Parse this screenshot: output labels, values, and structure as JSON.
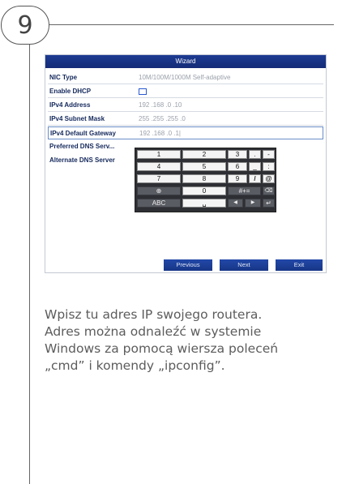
{
  "step": {
    "number": "9"
  },
  "wizard": {
    "title": "Wizard",
    "rows": [
      {
        "label": "NIC Type",
        "value": "10M/100M/1000M Self-adaptive"
      },
      {
        "label": "Enable DHCP",
        "value": ""
      },
      {
        "label": "IPv4 Address",
        "value": "192 .168 .0    .10"
      },
      {
        "label": "IPv4 Subnet Mask",
        "value": "255 .255 .255 .0"
      },
      {
        "label": "IPv4 Default Gateway",
        "value": "192 .168 .0    .1|"
      },
      {
        "label": "Preferred DNS Serv...",
        "value": ""
      },
      {
        "label": "Alternate DNS Server",
        "value": ""
      }
    ],
    "keypad": {
      "row1": [
        "1",
        "2",
        "3",
        ".",
        "-"
      ],
      "row2": [
        "4",
        "5",
        "6",
        "_",
        ":"
      ],
      "row3": [
        "7",
        "8",
        "9",
        "/",
        "@"
      ],
      "row4": [
        "⊕",
        "0",
        "#+=",
        "⌫"
      ],
      "row5": [
        "ABC",
        "␣",
        "◀",
        "▶",
        "↵"
      ]
    },
    "buttons": {
      "previous": "Previous",
      "next": "Next",
      "exit": "Exit"
    }
  },
  "instruction": {
    "line1": "Wpisz tu adres IP swojego routera.",
    "line2": "Adres można odnaleźć w systemie",
    "line3": "Windows za pomocą wiersza poleceń",
    "line4": "„cmd” i komendy „ipconfig”."
  }
}
